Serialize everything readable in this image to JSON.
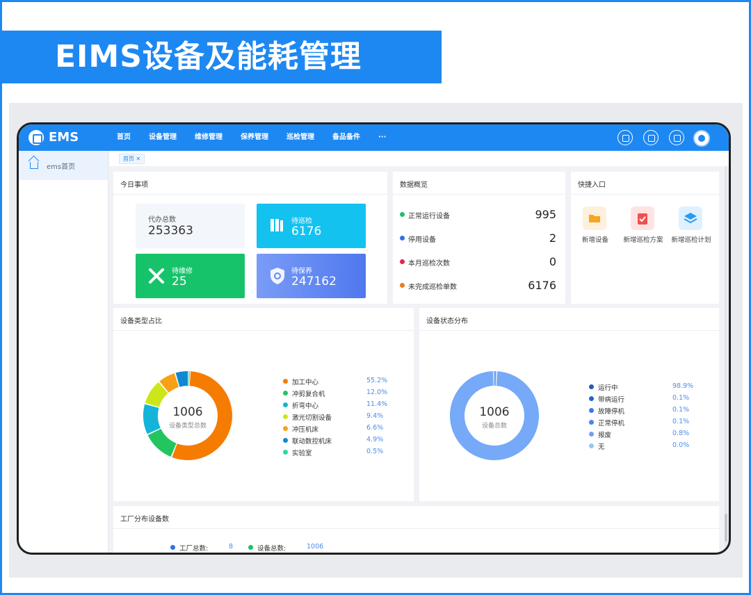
{
  "title": "EIMS设备及能耗管理",
  "app": {
    "logo": "EMS",
    "nav": [
      "首页",
      "设备管理",
      "维修管理",
      "保养管理",
      "巡检管理",
      "备品备件",
      "···"
    ],
    "topbar_icons": [
      "search-icon",
      "calculator-icon",
      "settings-icon",
      "avatar"
    ]
  },
  "sidebar": {
    "items": [
      {
        "label": "ems首页",
        "icon": "home-icon"
      }
    ]
  },
  "tabs": [
    {
      "label": "首页 ✕"
    }
  ],
  "todo": {
    "title": "今日事项",
    "items": [
      {
        "label": "代办总数",
        "value": "253363",
        "color": "#f3f6fb"
      },
      {
        "label": "待巡检",
        "value": "6176",
        "color": "#14c2f0",
        "icon": "inspection-icon"
      },
      {
        "label": "待维修",
        "value": "25",
        "color": "#17c36a",
        "icon": "wrench-icon"
      },
      {
        "label": "待保养",
        "value": "247162",
        "color": "#5f8af5",
        "icon": "shield-icon"
      }
    ]
  },
  "overview": {
    "title": "数据概览",
    "items": [
      {
        "label": "正常运行设备",
        "value": "995",
        "color": "#1ac26b"
      },
      {
        "label": "停用设备",
        "value": "2",
        "color": "#2f73e6"
      },
      {
        "label": "本月巡检次数",
        "value": "0",
        "color": "#e8244e"
      },
      {
        "label": "未完成巡检单数",
        "value": "6176",
        "color": "#f07a18"
      }
    ]
  },
  "quick": {
    "title": "快捷入口",
    "items": [
      {
        "label": "新增设备",
        "color": "#fff0dc",
        "icon": "folder-icon",
        "icon_color": "#f6a623"
      },
      {
        "label": "新增巡检方案",
        "color": "#ffe3e3",
        "icon": "clipboard-icon",
        "icon_color": "#f0504d"
      },
      {
        "label": "新增巡检计划",
        "color": "#dff1ff",
        "icon": "layers-icon",
        "icon_color": "#2a9af0"
      }
    ]
  },
  "type_chart": {
    "title": "设备类型占比",
    "center_value": "1006",
    "center_label": "设备类型总数"
  },
  "status_chart": {
    "title": "设备状态分布",
    "center_value": "1006",
    "center_label": "设备总数"
  },
  "factory": {
    "title": "工厂分布设备数",
    "stats": [
      {
        "label": "工厂总数:",
        "value": "8",
        "color": "#2f73e6"
      },
      {
        "label": "设备总数:",
        "value": "1006",
        "color": "#1ac26b"
      }
    ]
  },
  "chart_data": [
    {
      "type": "pie",
      "categories": [
        "加工中心",
        "冲剪复合机",
        "折弯中心",
        "激光切割设备",
        "冲压机床",
        "联动数控机床",
        "实验室"
      ],
      "values": [
        55.2,
        12.0,
        11.4,
        9.4,
        6.6,
        4.9,
        0.5
      ],
      "labels": [
        "55.2%",
        "12.0%",
        "11.4%",
        "9.4%",
        "6.6%",
        "4.9%",
        "0.5%"
      ],
      "colors": [
        "#f57c00",
        "#22c55e",
        "#14b4d8",
        "#cde619",
        "#f9a016",
        "#1188d0",
        "#2ed6a0"
      ],
      "legend": "right"
    },
    {
      "type": "pie",
      "categories": [
        "运行中",
        "带病运行",
        "故障停机",
        "正常停机",
        "报废",
        "无"
      ],
      "values": [
        98.9,
        0.1,
        0.1,
        0.1,
        0.8,
        0.0
      ],
      "labels": [
        "98.9%",
        "0.1%",
        "0.1%",
        "0.1%",
        "0.8%",
        "0.0%"
      ],
      "colors": [
        "#76a9f7",
        "#2a62c9",
        "#2f73e6",
        "#3f80ea",
        "#5a95f0",
        "#9cc0f8"
      ],
      "legend_colors": [
        "#1e5bc6",
        "#2a62c9",
        "#3a7ae6",
        "#4a86ea",
        "#6fa0f2",
        "#9cc0f8"
      ],
      "legend": "right"
    }
  ]
}
